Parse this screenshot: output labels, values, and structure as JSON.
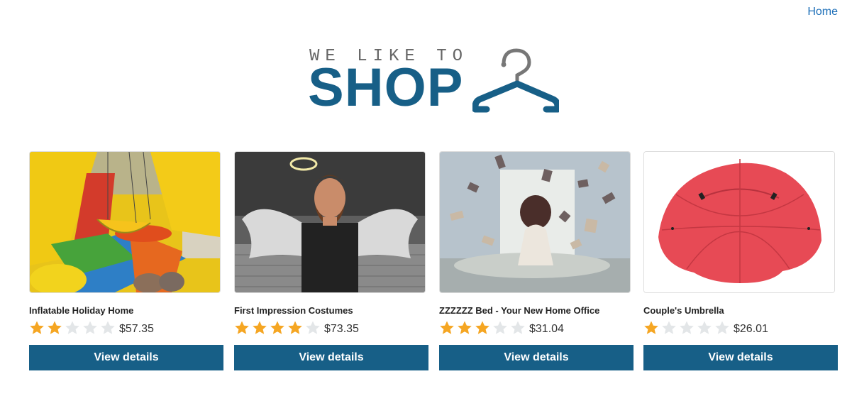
{
  "nav": {
    "home_label": "Home"
  },
  "logo": {
    "tagline": "WE LIKE TO",
    "main": "SHOP",
    "icon": "hanger-icon"
  },
  "products": [
    {
      "name": "Inflatable Holiday Home",
      "rating": 2,
      "max_rating": 5,
      "price": "$57.35",
      "button_label": "View details",
      "image": "inflatable-castle"
    },
    {
      "name": "First Impression Costumes",
      "rating": 4,
      "max_rating": 5,
      "price": "$73.35",
      "button_label": "View details",
      "image": "angel-costume"
    },
    {
      "name": "ZZZZZZ Bed - Your New Home Office",
      "rating": 3,
      "max_rating": 5,
      "price": "$31.04",
      "button_label": "View details",
      "image": "flying-books-bed"
    },
    {
      "name": "Couple's Umbrella",
      "rating": 1,
      "max_rating": 5,
      "price": "$26.01",
      "button_label": "View details",
      "image": "red-umbrella"
    }
  ],
  "colors": {
    "brand": "#175f87",
    "star_filled": "#f5a623",
    "star_empty": "#e3e6e8",
    "link": "#1d6fb8"
  }
}
